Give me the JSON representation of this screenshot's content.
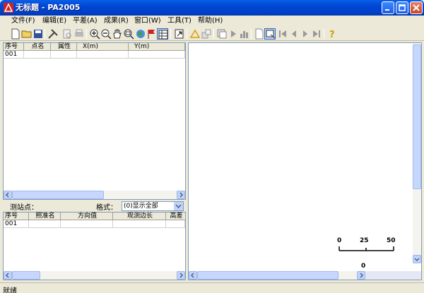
{
  "window": {
    "title": "无标题 - PA2005",
    "controls": {
      "minimize": "minimize",
      "maximize": "maximize",
      "close": "close"
    }
  },
  "menu": {
    "items": [
      {
        "label": "文件(F)"
      },
      {
        "label": "编辑(E)"
      },
      {
        "label": "平差(A)"
      },
      {
        "label": "成果(R)"
      },
      {
        "label": "窗口(W)"
      },
      {
        "label": "工具(T)"
      },
      {
        "label": "帮助(H)"
      }
    ]
  },
  "toolbar": {
    "icons": [
      "new-file-icon",
      "open-folder-icon",
      "save-icon",
      "tools-icon",
      "print-preview-icon",
      "print-icon",
      "zoom-in-icon",
      "zoom-out-icon",
      "pan-hand-icon",
      "zoom-window-icon",
      "globe-icon",
      "flag-icon",
      "grid-table-icon",
      "export-icon",
      "triangle-icon",
      "network-icon",
      "layers-icon",
      "play-icon",
      "chart-icon",
      "page-icon",
      "select-icon",
      "first-icon",
      "prev-icon",
      "next-icon",
      "last-icon",
      "help-icon"
    ]
  },
  "points_table": {
    "headers": [
      "序号",
      "点名",
      "属性",
      "X(m)",
      "Y(m)"
    ],
    "rows": [
      [
        "001",
        "",
        "",
        "",
        ""
      ]
    ]
  },
  "station": {
    "label": "测站点：",
    "format_label": "格式：",
    "format_value": "(0)显示全部"
  },
  "obs_table": {
    "headers": [
      "序号",
      "照准名",
      "方向值",
      "观测边长",
      "高差"
    ],
    "rows": [
      [
        "001",
        "",
        "",
        "",
        ""
      ]
    ]
  },
  "scale_bar": {
    "labels": [
      "0",
      "25",
      "50"
    ],
    "origin_label": "0"
  },
  "status": {
    "text": "就绪"
  }
}
